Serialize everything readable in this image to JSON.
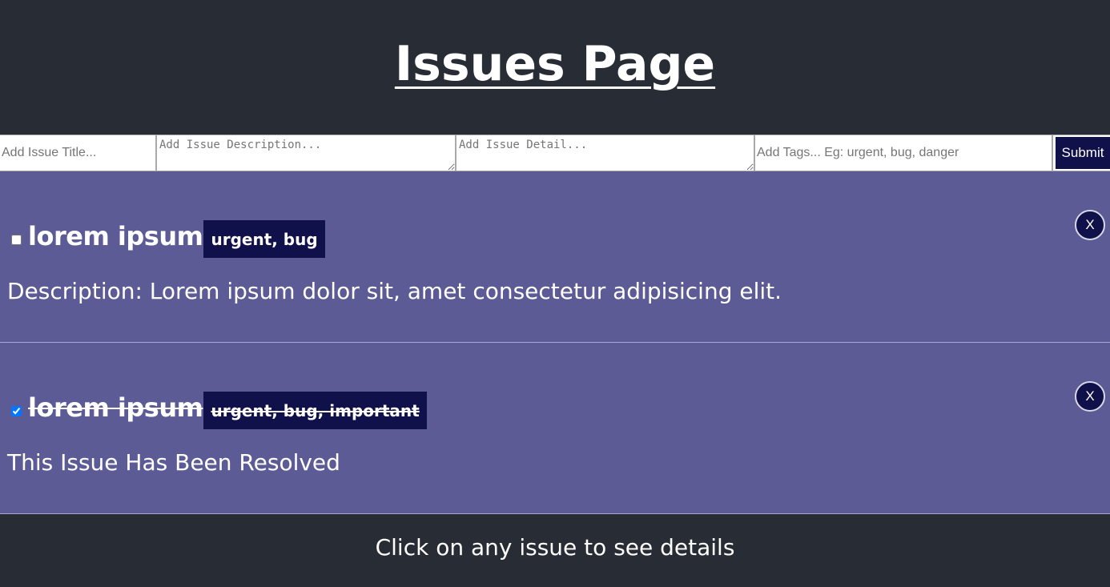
{
  "header": {
    "title": "Issues Page"
  },
  "form": {
    "title_placeholder": "Add Issue Title...",
    "description_placeholder": "Add Issue Description...",
    "detail_placeholder": "Add Issue Detail...",
    "tags_placeholder": "Add Tags... Eg: urgent, bug, danger",
    "submit_label": "Submit"
  },
  "issues": [
    {
      "title": "lorem ipsum",
      "tags": "urgent, bug",
      "resolved": false,
      "description": "Description: Lorem ipsum dolor sit, amet consectetur adipisicing elit.",
      "close_label": "X"
    },
    {
      "title": "lorem ipsum",
      "tags": "urgent, bug, important",
      "resolved": true,
      "description": "This Issue Has Been Resolved",
      "close_label": "X"
    }
  ],
  "footer": {
    "text": "Click on any issue to see details"
  },
  "colors": {
    "background": "#282c35",
    "issue_background": "#5d5b96",
    "accent": "#10104a"
  }
}
